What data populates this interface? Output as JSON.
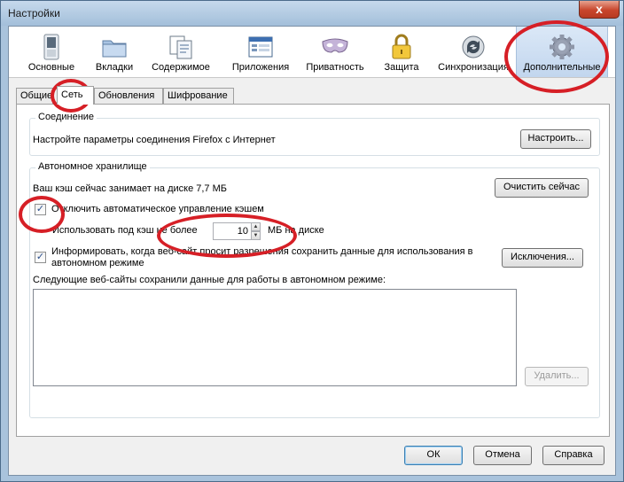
{
  "window": {
    "title": "Настройки",
    "close_glyph": "x"
  },
  "toolbar": {
    "items": [
      {
        "label": "Основные",
        "icon": "switch-icon"
      },
      {
        "label": "Вкладки",
        "icon": "folder-icon"
      },
      {
        "label": "Содержимое",
        "icon": "documents-icon"
      },
      {
        "label": "Приложения",
        "icon": "applications-icon"
      },
      {
        "label": "Приватность",
        "icon": "mask-icon"
      },
      {
        "label": "Защита",
        "icon": "lock-icon"
      },
      {
        "label": "Синхронизация",
        "icon": "sync-icon"
      },
      {
        "label": "Дополнительные",
        "icon": "gear-icon"
      }
    ],
    "active_index": 7,
    "accent_color": "#c2d6ee"
  },
  "tabs": {
    "items": [
      "Общие",
      "Сеть",
      "Обновления",
      "Шифрование"
    ],
    "active_index": 1
  },
  "connection": {
    "legend": "Соединение",
    "description": "Настройте параметры соединения Firefox с Интернет",
    "button": "Настроить..."
  },
  "offline": {
    "legend": "Автономное хранилище",
    "cache_usage": "Ваш кэш сейчас занимает на диске 7,7 МБ",
    "clear_button": "Очистить сейчас",
    "override_checkbox": {
      "label": "Отключить автоматическое управление кэшем",
      "checked": true
    },
    "limit_prefix": "Использовать под кэш не более",
    "limit_value": "10",
    "limit_suffix": "МБ на диске",
    "notify_checkbox": {
      "label": "Информировать, когда веб-сайт просит разрешения сохранить данные для использования в автономном режиме",
      "checked": true
    },
    "exceptions_button": "Исключения...",
    "sites_label": "Следующие веб-сайты сохранили данные для работы в автономном режиме:",
    "sites": [],
    "remove_button": "Удалить..."
  },
  "footer": {
    "ok": "ОК",
    "cancel": "Отмена",
    "help": "Справка"
  },
  "annotation_color": "#d61f26"
}
